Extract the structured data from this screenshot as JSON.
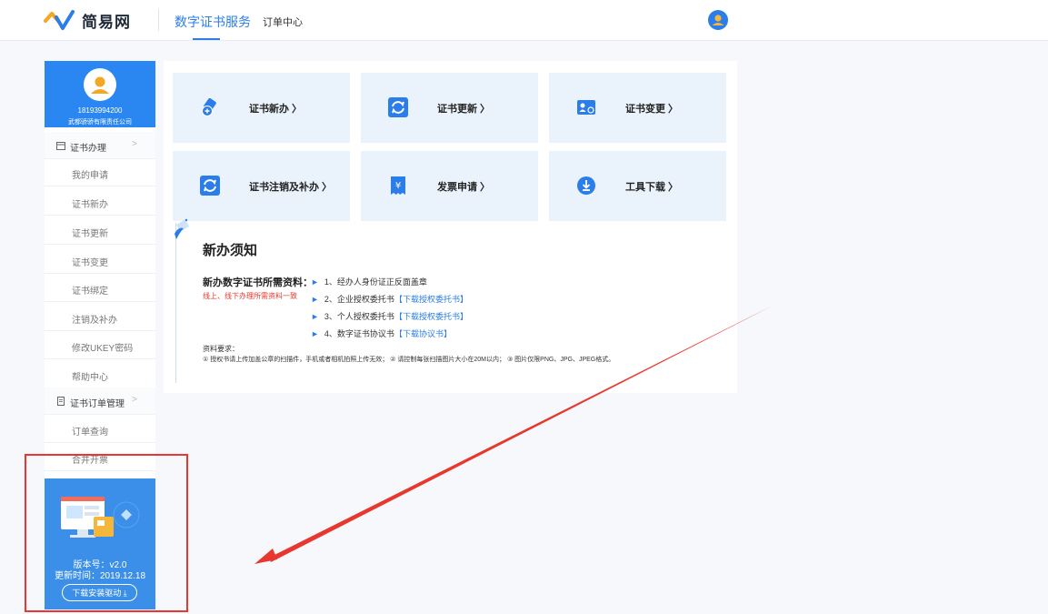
{
  "header": {
    "logo_text": "简易网",
    "nav_main": "数字证书服务",
    "nav_orders": "订单中心"
  },
  "profile": {
    "phone": "18193994200",
    "company": "武都骄骄有限责任公司"
  },
  "sidebar": {
    "group1": "证书办理",
    "group1_items": [
      "我的申请",
      "证书新办",
      "证书更新",
      "证书变更",
      "证书绑定",
      "注销及补办",
      "修改UKEY密码",
      "帮助中心"
    ],
    "group2": "证书订单管理",
    "group2_items": [
      "订单查询",
      "合并开票"
    ]
  },
  "promo": {
    "version": "版本号：v2.0",
    "date": "更新时间：2019.12.18",
    "button": "下载安装驱动 ⤓"
  },
  "cards": [
    {
      "label": "证书新办 〉",
      "icon": "new-cert-icon"
    },
    {
      "label": "证书更新 〉",
      "icon": "refresh-icon"
    },
    {
      "label": "证书变更 〉",
      "icon": "change-cert-icon"
    },
    {
      "label": "证书注销及补办 〉",
      "icon": "reissue-icon"
    },
    {
      "label": "发票申请 〉",
      "icon": "invoice-icon"
    },
    {
      "label": "工具下载 〉",
      "icon": "download-icon"
    }
  ],
  "notice": {
    "title": "新办须知",
    "req_head": "新办数字证书所需资料：",
    "req_note": "线上、线下办理所需资料一致",
    "items": [
      {
        "text": "1、经办人身份证正反面盖章",
        "link": ""
      },
      {
        "text": "2、企业授权委托书",
        "link": "【下载授权委托书】"
      },
      {
        "text": "3、个人授权委托书",
        "link": "【下载授权委托书】"
      },
      {
        "text": "4、数字证书协议书",
        "link": "【下载协议书】"
      }
    ],
    "mat_head": "资料要求：",
    "mat_text": "① 授权书请上传加盖公章的扫描件，手机或者相机拍照上传无效；  ② 请控制每张扫描图片大小在20M以内；  ③ 图片仅限PNG、JPG、JPEG格式。"
  },
  "colors": {
    "accent": "#2b7de9",
    "sidebar_profile": "#2a86f0",
    "card_bg": "#eaf3fc",
    "annotation_red": "#e8372e"
  }
}
